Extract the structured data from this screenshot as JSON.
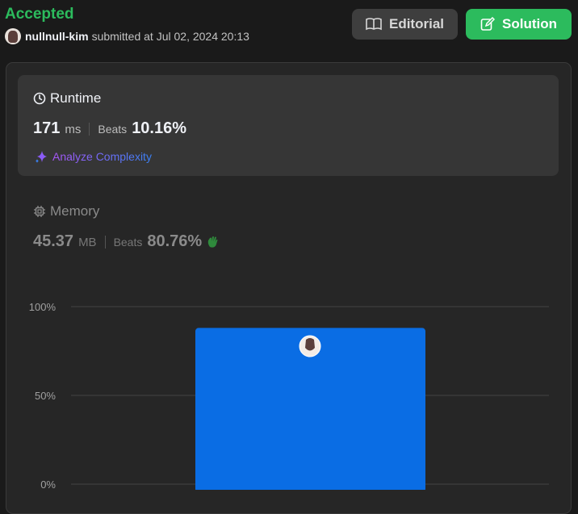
{
  "header": {
    "status": "Accepted",
    "username": "nullnull-kim",
    "submitted_text": "submitted at Jul 02, 2024 20:13"
  },
  "buttons": {
    "editorial": "Editorial",
    "solution": "Solution"
  },
  "runtime": {
    "title": "Runtime",
    "value": "171",
    "unit": "ms",
    "beats_label": "Beats",
    "beats_value": "10.16%",
    "analyze": "Analyze Complexity"
  },
  "memory": {
    "title": "Memory",
    "value": "45.37",
    "unit": "MB",
    "beats_label": "Beats",
    "beats_value": "80.76%"
  },
  "colors": {
    "accepted": "#2cbb5d",
    "bar": "#0a6de4",
    "solution_button": "#2cbb5d"
  },
  "chart_data": {
    "type": "bar",
    "categories": [
      ""
    ],
    "values": [
      88
    ],
    "ylim": [
      0,
      100
    ],
    "yticks": [
      "0%",
      "50%",
      "100%"
    ],
    "ytick_values": [
      0,
      50,
      100
    ],
    "grid": true
  }
}
